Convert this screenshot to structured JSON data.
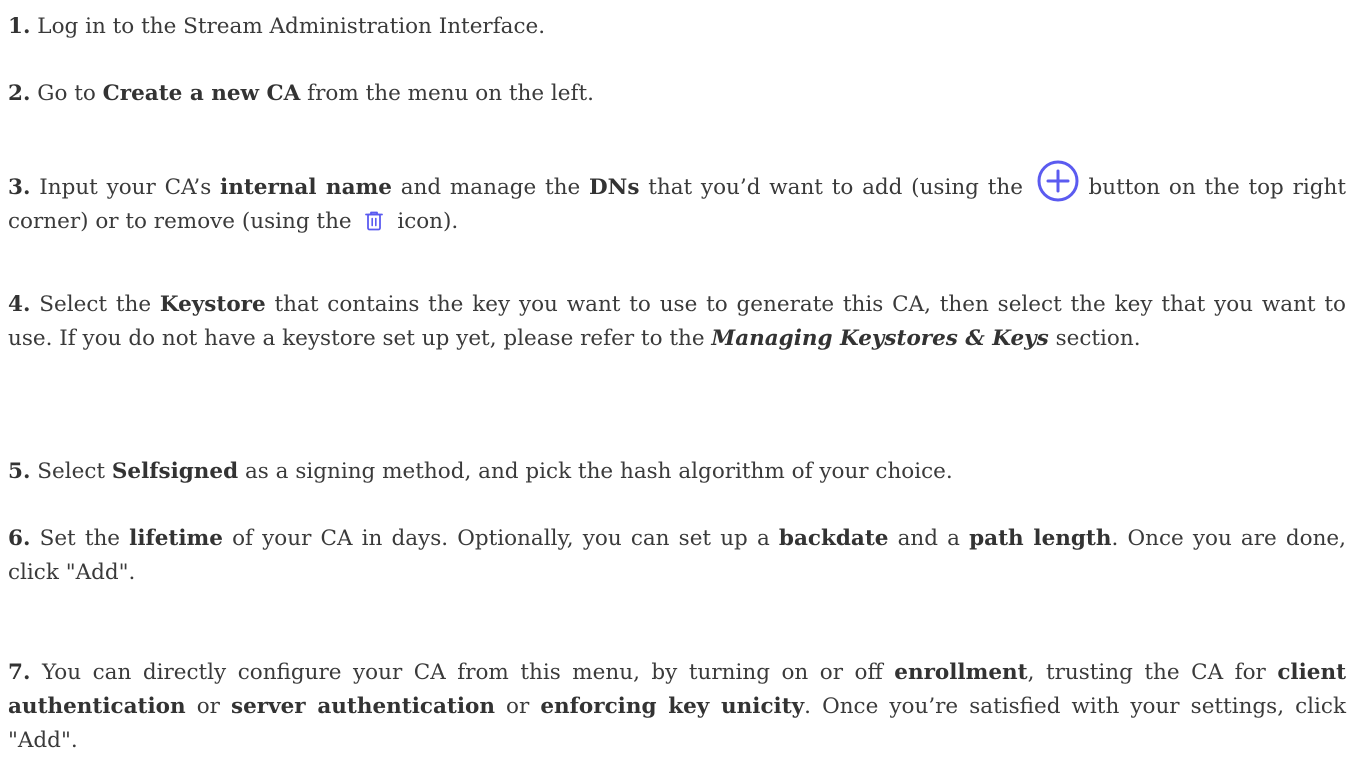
{
  "accent_color": "#5b5bf0",
  "steps": [
    {
      "num": "1.",
      "t1": " Log in to the Stream Administration Interface."
    },
    {
      "num": "2.",
      "t1": " Go to ",
      "b1": "Create a new CA",
      "t2": " from the menu on the left."
    },
    {
      "num": "3.",
      "t1": " Input your CA’s ",
      "b1": "internal name",
      "t2": " and manage the ",
      "b2": "DNs",
      "t3": " that you’d want to add (using the ",
      "icon1": "plus-circle-icon",
      "t4": " button on the top right corner) or to remove (using the ",
      "icon2": "trash-icon",
      "t5": " icon)."
    },
    {
      "num": "4.",
      "t1": " Select the ",
      "b1": "Keystore",
      "t2": " that contains the key you want to use to generate this CA, then select the key that you want to use. If you do not have a keystore set up yet, please refer to the ",
      "em1": "Managing Keystores & Keys",
      "t3": " section."
    },
    {
      "num": "5.",
      "t1": " Select ",
      "b1": "Selfsigned",
      "t2": " as a signing method, and pick the hash algorithm of your choice."
    },
    {
      "num": "6.",
      "t1": " Set the ",
      "b1": "lifetime",
      "t2": " of your CA in days. Optionally, you can set up a ",
      "b2": "backdate",
      "t3": " and a ",
      "b3": "path length",
      "t4": ". Once you are done, click \"Add\"."
    },
    {
      "num": "7.",
      "t1": " You can directly configure your CA from this menu, by turning on or off ",
      "b1": "enrollment",
      "t2": ", trusting the CA for ",
      "b2": "client authentication",
      "t3": " or ",
      "b3": "server authentication",
      "t4": " or ",
      "b4": "enforcing key unicity",
      "t5": ". Once you’re satisfied with your settings, click \"Add\"."
    }
  ]
}
